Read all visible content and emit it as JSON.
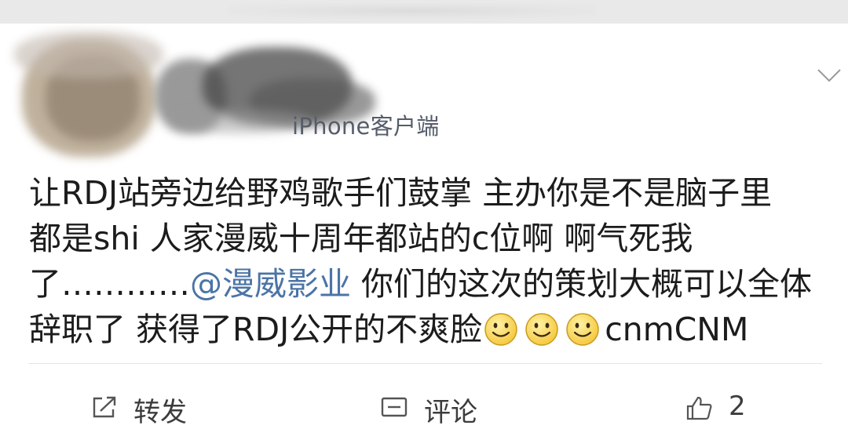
{
  "post": {
    "source": "iPhone客户端",
    "lines": [
      {
        "text": "让RDJ站旁边给野鸡歌手们鼓掌 主办你是不是脑子里"
      },
      {
        "text": "都是shi 人家漫威十周年都站的c位啊  啊气死我"
      },
      {
        "prefix": "了…………",
        "mention": "@漫威影业",
        "suffix": " 你们的这次的策划大概可以全体"
      },
      {
        "text": "辞职了 获得了RDJ公开的不爽脸",
        "emoji_count": 3,
        "emoji_name": "smile-emoji",
        "tail": "cnmCNM"
      }
    ]
  },
  "actions": {
    "forward": {
      "label": "转发",
      "icon": "share-icon"
    },
    "comment": {
      "label": "评论",
      "icon": "comment-icon"
    },
    "like": {
      "count": "2",
      "icon": "thumbs-up-icon"
    }
  },
  "colors": {
    "mention": "#4b74a6",
    "source": "#555c6a",
    "emoji": "#f6c940"
  }
}
